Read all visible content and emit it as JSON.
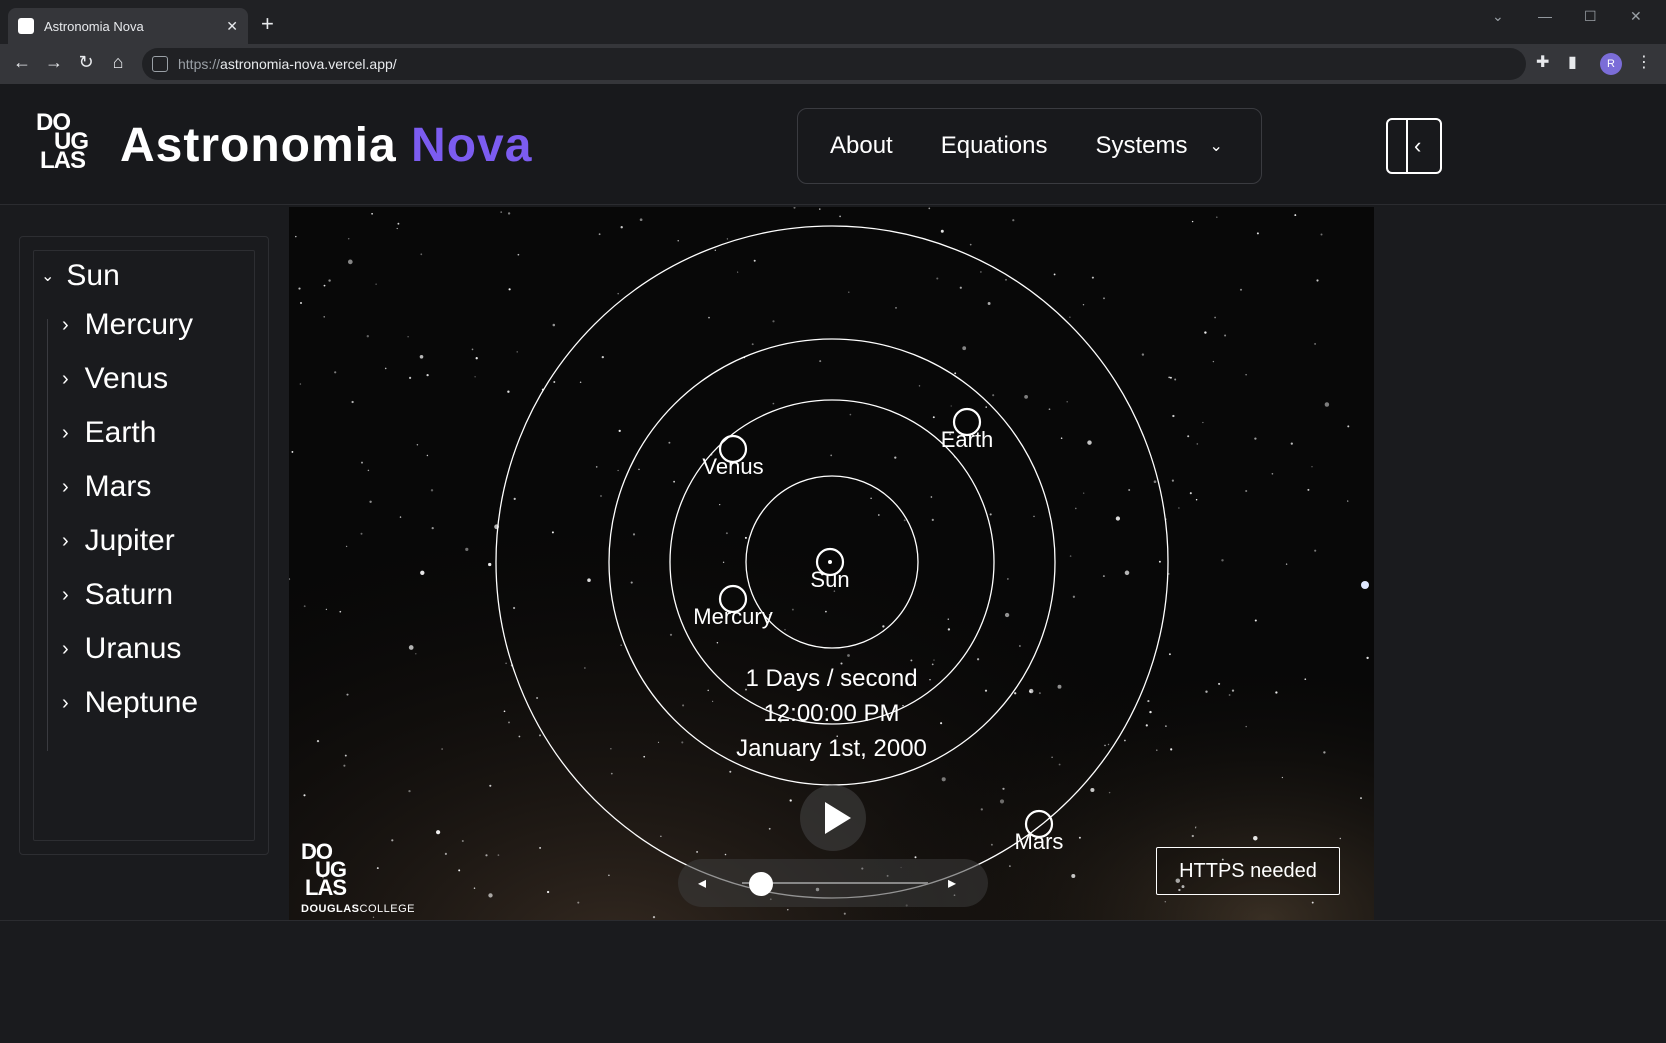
{
  "browser": {
    "tab_title": "Astronomia Nova",
    "tab_close": "✕",
    "new_tab": "+",
    "url_protocol": "https://",
    "url_rest": "astronomia-nova.vercel.app/",
    "profile_initial": "R",
    "icons": [
      "back-icon",
      "forward-icon",
      "reload-icon",
      "home-icon",
      "extensions-icon",
      "sidepanel-icon",
      "menu-icon"
    ]
  },
  "header": {
    "logo_lines": [
      "DO",
      "UG",
      "LAS"
    ],
    "brand_main": "Astronomia ",
    "brand_accent": "Nova",
    "accent_color": "#7c5cf0",
    "nav": {
      "about": "About",
      "equations": "Equations",
      "systems": "Systems"
    }
  },
  "sidebar": {
    "root": "Sun",
    "items": [
      "Mercury",
      "Venus",
      "Earth",
      "Mars",
      "Jupiter",
      "Saturn",
      "Uranus",
      "Neptune"
    ]
  },
  "simulation": {
    "bodies": [
      "Sun",
      "Mercury",
      "Venus",
      "Earth",
      "Mars"
    ],
    "speed": "1 Days / second",
    "time": "12:00:00 PM",
    "date": "January 1st, 2000",
    "speed_slider_fraction": 0.1,
    "https_notice": "HTTPS needed",
    "college_logo_lines": [
      "DO",
      "UG",
      "LAS"
    ],
    "college_word_bold": "DOUGLAS",
    "college_word": "COLLEGE"
  }
}
